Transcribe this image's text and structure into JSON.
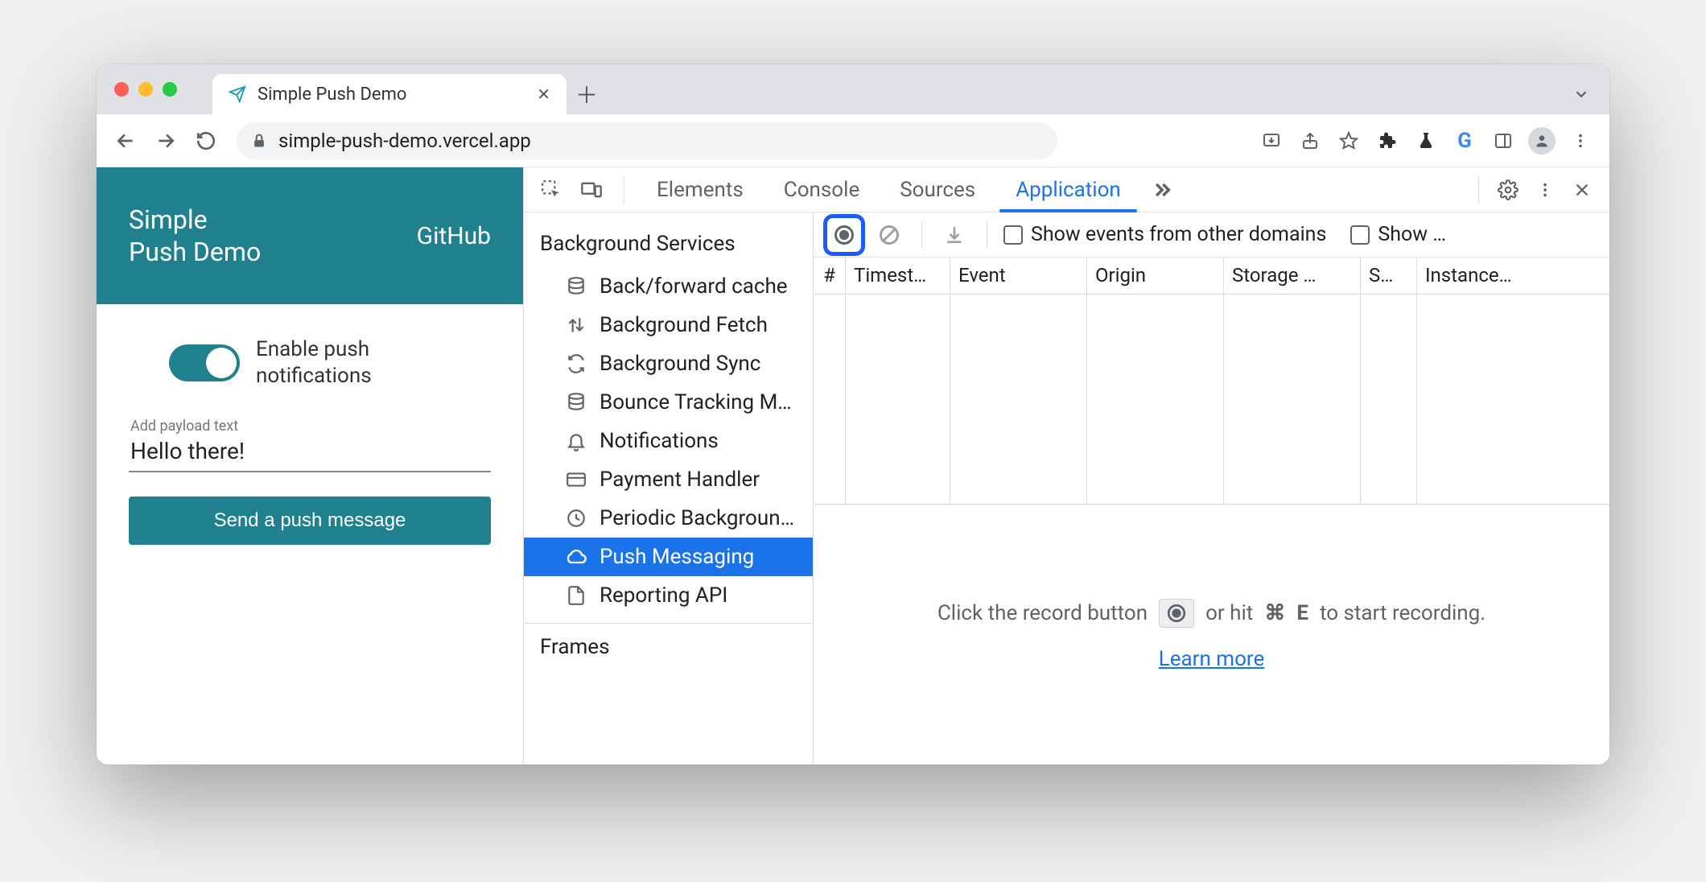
{
  "browser": {
    "tab_title": "Simple Push Demo",
    "url": "simple-push-demo.vercel.app"
  },
  "demo": {
    "title_line1": "Simple",
    "title_line2": "Push Demo",
    "github_link": "GitHub",
    "toggle_label_line1": "Enable push",
    "toggle_label_line2": "notifications",
    "payload_label": "Add payload text",
    "payload_value": "Hello there!",
    "send_button": "Send a push message"
  },
  "devtools": {
    "tabs": {
      "elements": "Elements",
      "console": "Console",
      "sources": "Sources",
      "application": "Application"
    },
    "sidebar": {
      "header1": "Background Services",
      "items": [
        "Back/forward cache",
        "Background Fetch",
        "Background Sync",
        "Bounce Tracking Mitigations",
        "Notifications",
        "Payment Handler",
        "Periodic Background Sync",
        "Push Messaging",
        "Reporting API"
      ],
      "header2": "Frames"
    },
    "events": {
      "checkbox1": "Show events from other domains",
      "checkbox2": "Show …",
      "columns": [
        "#",
        "Timest…",
        "Event",
        "Origin",
        "Storage …",
        "S…",
        "Instance…"
      ],
      "prompt_pre": "Click the record button",
      "prompt_post_1": "or hit",
      "prompt_key1": "⌘",
      "prompt_key2": "E",
      "prompt_post_2": "to start recording.",
      "learn_more": "Learn more"
    }
  }
}
